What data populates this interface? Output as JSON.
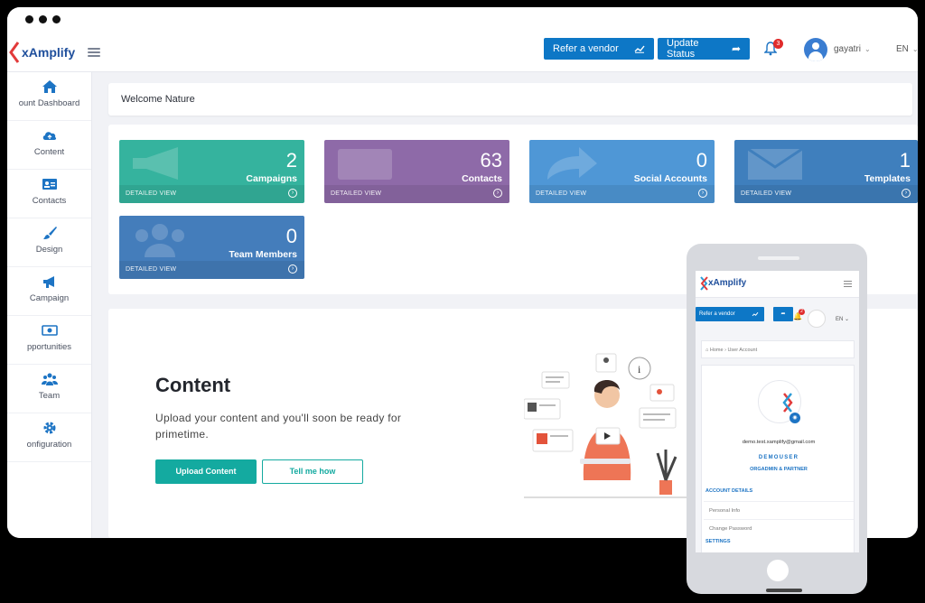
{
  "brand": {
    "name": "xAmplify",
    "colors": {
      "primary": "#0d77c6",
      "teal": "#14aaa0",
      "navy": "#1f4f9c",
      "red": "#e02b2b"
    }
  },
  "header": {
    "refer_vendor": "Refer a vendor",
    "update_status": "Update Status",
    "notification_count": "3",
    "user_name": "gayatri",
    "language": "EN"
  },
  "sidebar": {
    "items": [
      {
        "label": "ount Dashboard",
        "icon": "home-icon"
      },
      {
        "label": "Content",
        "icon": "cloud-upload-icon"
      },
      {
        "label": "Contacts",
        "icon": "contact-card-icon"
      },
      {
        "label": "Design",
        "icon": "paintbrush-icon"
      },
      {
        "label": "Campaign",
        "icon": "megaphone-icon"
      },
      {
        "label": "pportunities",
        "icon": "money-icon"
      },
      {
        "label": "Team",
        "icon": "team-icon"
      },
      {
        "label": "onfiguration",
        "icon": "gear-icon"
      }
    ]
  },
  "welcome": "Welcome Nature",
  "stats": [
    {
      "value": "2",
      "label": "Campaigns",
      "footer": "DETAILED VIEW",
      "color": "#35b39e"
    },
    {
      "value": "63",
      "label": "Contacts",
      "footer": "DETAILED VIEW",
      "color": "#8e6aa8"
    },
    {
      "value": "0",
      "label": "Social Accounts",
      "footer": "DETAILED VIEW",
      "color": "#4f97d6"
    },
    {
      "value": "1",
      "label": "Templates",
      "footer": "DETAILED VIEW",
      "color": "#3f7fbd"
    },
    {
      "value": "0",
      "label": "Team Members",
      "footer": "DETAILED VIEW",
      "color": "#447dbb"
    }
  ],
  "content": {
    "title": "Content",
    "description": "Upload your content and you'll soon be ready for primetime.",
    "upload_button": "Upload Content",
    "tell_button": "Tell me how"
  },
  "mobile": {
    "refer_vendor": "Refer a vendor",
    "notification_count": "2",
    "language": "EN",
    "breadcrumb_home": "Home",
    "breadcrumb_current": "User Account",
    "email": "demo.test.xamplify@gmail.com",
    "username": "DEMOUSER",
    "role": "ORGADMIN & PARTNER",
    "account_details": "ACCOUNT DETAILS",
    "personal_info": "Personal Info",
    "change_password": "Change Password",
    "settings": "SETTINGS"
  }
}
